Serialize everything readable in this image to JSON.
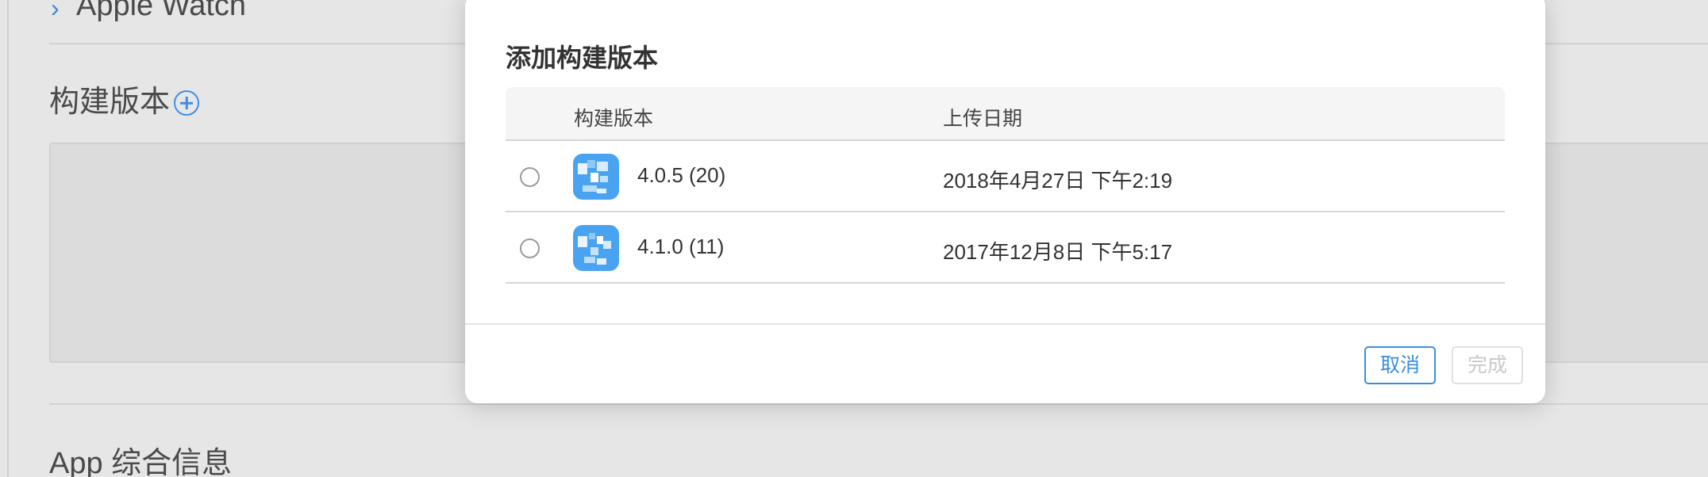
{
  "background": {
    "section_watch": "Apple Watch",
    "section_build": "构建版本",
    "section_app_info": "App 综合信息",
    "accent_color": "#3f8ee3"
  },
  "modal": {
    "title": "添加构建版本",
    "columns": {
      "build": "构建版本",
      "upload_date": "上传日期"
    },
    "rows": [
      {
        "build": "4.0.5 (20)",
        "upload_date": "2018年4月27日 下午2:19",
        "selected": false
      },
      {
        "build": "4.1.0 (11)",
        "upload_date": "2017年12月8日 下午5:17",
        "selected": false
      }
    ],
    "buttons": {
      "cancel": "取消",
      "done": "完成"
    }
  },
  "icons": {
    "chevron": "chevron-right-icon",
    "add": "add-circle-icon",
    "app": "app-icon-pixelated"
  }
}
